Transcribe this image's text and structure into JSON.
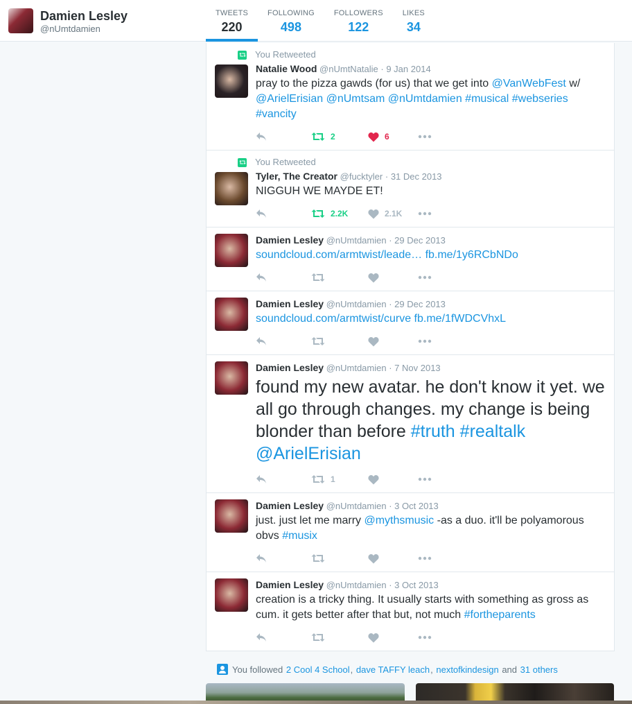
{
  "profile": {
    "name": "Damien Lesley",
    "handle": "@nUmtdamien",
    "colors": {
      "avatar": "#8c2a35",
      "accent": "#1b95e0"
    }
  },
  "stats": [
    {
      "label": "TWEETS",
      "value": "220",
      "active": true
    },
    {
      "label": "FOLLOWING",
      "value": "498",
      "active": false
    },
    {
      "label": "FOLLOWERS",
      "value": "122",
      "active": false
    },
    {
      "label": "LIKES",
      "value": "34",
      "active": false
    }
  ],
  "tweets": [
    {
      "context": "You Retweeted",
      "name": "Natalie Wood",
      "handle": "@nUmtNatalie",
      "date": "9 Jan 2014",
      "text": [
        {
          "t": "pray to the pizza gawds (for us) that we get into ",
          "link": false
        },
        {
          "t": "@VanWebFest",
          "link": true
        },
        {
          "t": " w/ ",
          "link": false
        },
        {
          "t": "@ArielErisian",
          "link": true
        },
        {
          "t": " ",
          "link": false
        },
        {
          "t": "@nUmtsam",
          "link": true
        },
        {
          "t": " ",
          "link": false
        },
        {
          "t": "@nUmtdamien",
          "link": true
        },
        {
          "t": " ",
          "link": false
        },
        {
          "t": "#musical",
          "link": true
        },
        {
          "t": " ",
          "link": false
        },
        {
          "t": "#webseries",
          "link": true
        },
        {
          "t": " ",
          "link": false
        },
        {
          "t": "#vancity",
          "link": true
        }
      ],
      "retweets": "2",
      "likes": "6",
      "retweeted": true,
      "liked": true,
      "avatar_color": "#2a2226"
    },
    {
      "context": "You Retweeted",
      "name": "Tyler, The Creator",
      "handle": "@fucktyler",
      "date": "31 Dec 2013",
      "text": [
        {
          "t": "NIGGUH WE MAYDE ET!",
          "link": false
        }
      ],
      "retweets": "2.2K",
      "likes": "2.1K",
      "retweeted": true,
      "liked": false,
      "avatar_color": "#6b4a2e"
    },
    {
      "context": "",
      "name": "Damien Lesley",
      "handle": "@nUmtdamien",
      "date": "29 Dec 2013",
      "text": [
        {
          "t": "soundcloud.com/armtwist/leade…",
          "link": true
        },
        {
          "t": " ",
          "link": false
        },
        {
          "t": "fb.me/1y6RCbNDo",
          "link": true
        }
      ],
      "retweets": "",
      "likes": "",
      "retweeted": false,
      "liked": false,
      "avatar_color": "#8c2a35"
    },
    {
      "context": "",
      "name": "Damien Lesley",
      "handle": "@nUmtdamien",
      "date": "29 Dec 2013",
      "text": [
        {
          "t": "soundcloud.com/armtwist/curve",
          "link": true
        },
        {
          "t": " ",
          "link": false
        },
        {
          "t": "fb.me/1fWDCVhxL",
          "link": true
        }
      ],
      "retweets": "",
      "likes": "",
      "retweeted": false,
      "liked": false,
      "avatar_color": "#8c2a35"
    },
    {
      "context": "",
      "name": "Damien Lesley",
      "handle": "@nUmtdamien",
      "date": "7 Nov 2013",
      "large": true,
      "text": [
        {
          "t": "found my new avatar. he don't know it yet. we all go through changes. my change is being blonder than before ",
          "link": false
        },
        {
          "t": "#truth",
          "link": true
        },
        {
          "t": " ",
          "link": false
        },
        {
          "t": "#realtalk",
          "link": true
        },
        {
          "t": " ",
          "link": false
        },
        {
          "t": "@ArielErisian",
          "link": true
        }
      ],
      "retweets": "1",
      "likes": "",
      "retweeted": false,
      "liked": false,
      "avatar_color": "#8c2a35"
    },
    {
      "context": "",
      "name": "Damien Lesley",
      "handle": "@nUmtdamien",
      "date": "3 Oct 2013",
      "text": [
        {
          "t": "just. just let me marry ",
          "link": false
        },
        {
          "t": "@mythsmusic",
          "link": true
        },
        {
          "t": " -as a duo. it'll be polyamorous obvs ",
          "link": false
        },
        {
          "t": "#musix",
          "link": true
        }
      ],
      "retweets": "",
      "likes": "",
      "retweeted": false,
      "liked": false,
      "avatar_color": "#8c2a35"
    },
    {
      "context": "",
      "name": "Damien Lesley",
      "handle": "@nUmtdamien",
      "date": "3 Oct 2013",
      "text": [
        {
          "t": "creation is a tricky thing. It usually starts with something as gross as cum. it gets better after that but, not much ",
          "link": false
        },
        {
          "t": "#fortheparents",
          "link": true
        }
      ],
      "retweets": "",
      "likes": "",
      "retweeted": false,
      "liked": false,
      "avatar_color": "#8c2a35"
    }
  ],
  "followed": {
    "prefix": "You followed",
    "names": [
      "2 Cool 4 School",
      "dave TAFFY leach",
      "nextofkindesign"
    ],
    "and": "and",
    "others": "31 others"
  }
}
